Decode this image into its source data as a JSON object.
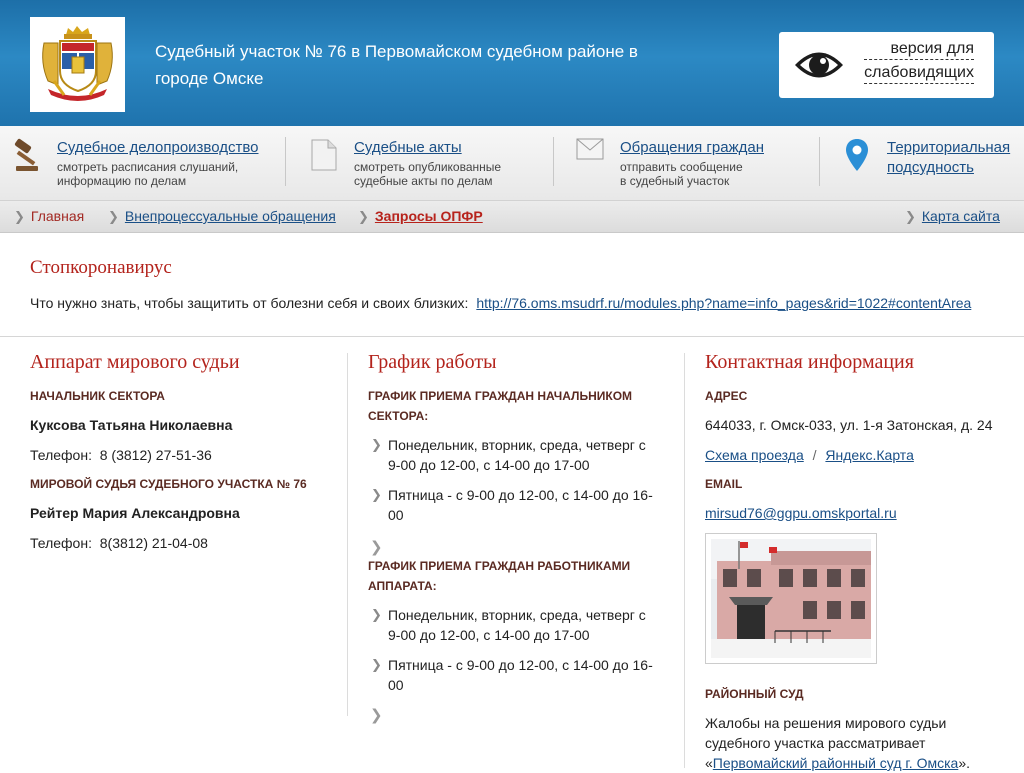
{
  "header": {
    "title": "Судебный участок № 76 в Первомайском судебном районе в городе Омске",
    "vision_line1": "версия для",
    "vision_line2": "слабовидящих"
  },
  "quick_links": [
    {
      "label": "Судебное делопроизводство",
      "desc1": "смотреть расписания слушаний,",
      "desc2": "информацию по делам",
      "icon": "gavel-icon"
    },
    {
      "label": "Судебные акты",
      "desc1": "смотреть опубликованные",
      "desc2": "судебные акты по делам",
      "icon": "document-icon"
    },
    {
      "label": "Обращения граждан",
      "desc1": "отправить сообщение",
      "desc2": "в судебный участок",
      "icon": "envelope-icon"
    },
    {
      "label1": "Территориальная",
      "label2": "подсудность",
      "icon": "map-pin-icon"
    }
  ],
  "breadcrumb": {
    "items": [
      "Главная",
      "Внепроцессуальные обращения",
      "Запросы ОПФР"
    ],
    "sitemap": "Карта сайта"
  },
  "notice": {
    "title": "Стопкоронавирус",
    "text": "Что нужно знать, чтобы защитить от болезни себя и своих близких:",
    "link": "http://76.oms.msudrf.ru/modules.php?name=info_pages&rid=1022#contentArea"
  },
  "apparatus": {
    "title": "Аппарат мирового судьи",
    "head_label": "НАЧАЛЬНИК СЕКТОРА",
    "head_name": "Куксова Татьяна Николаевна",
    "head_phone": "Телефон:  8 (3812) 27-51-36",
    "judge_label": "МИРОВОЙ СУДЬЯ СУДЕБНОГО УЧАСТКА № 76",
    "judge_name": "Рейтер Мария Александровна",
    "judge_phone": "Телефон:  8(3812) 21-04-08"
  },
  "schedule": {
    "title": "График работы",
    "head_label1": "ГРАФИК ПРИЕМА ГРАЖДАН НАЧАЛЬНИКОМ",
    "head_label2": "СЕКТОРА:",
    "head_item1_l1": "Понедельник, вторник, среда, четверг с",
    "head_item1_l2": "9-00 до 12-00, с 14-00 до 17-00",
    "head_item2_l1": "Пятница - с 9-00 до 12-00, с 14-00 до 16-",
    "head_item2_l2": "00",
    "staff_label1": "ГРАФИК ПРИЕМА ГРАЖДАН РАБОТНИКАМИ",
    "staff_label2": "АППАРАТА:",
    "staff_item1_l1": "Понедельник, вторник, среда, четверг с",
    "staff_item1_l2": "9-00 до 12-00, с 14-00 до 17-00",
    "staff_item2_l1": "Пятница - с 9-00 до 12-00, с 14-00 до 16-",
    "staff_item2_l2": "00"
  },
  "contacts": {
    "title": "Контактная информация",
    "address_label": "АДРЕС",
    "address": "644033, г. Омск-033, ул. 1-я Затонская, д. 24",
    "route_link": "Схема проезда",
    "sep": "/",
    "map_link": "Яндекс.Карта",
    "email_label": "EMAIL",
    "email": "mirsud76@ggpu.omskportal.ru",
    "court_label": "РАЙОННЫЙ СУД",
    "court_text1": "Жалобы на решения мирового судьи",
    "court_text2": "судебного участка рассматривает",
    "court_text3_pre": "«",
    "court_link": "Первомайский районный суд г. Омска",
    "court_text3_post": "»."
  }
}
